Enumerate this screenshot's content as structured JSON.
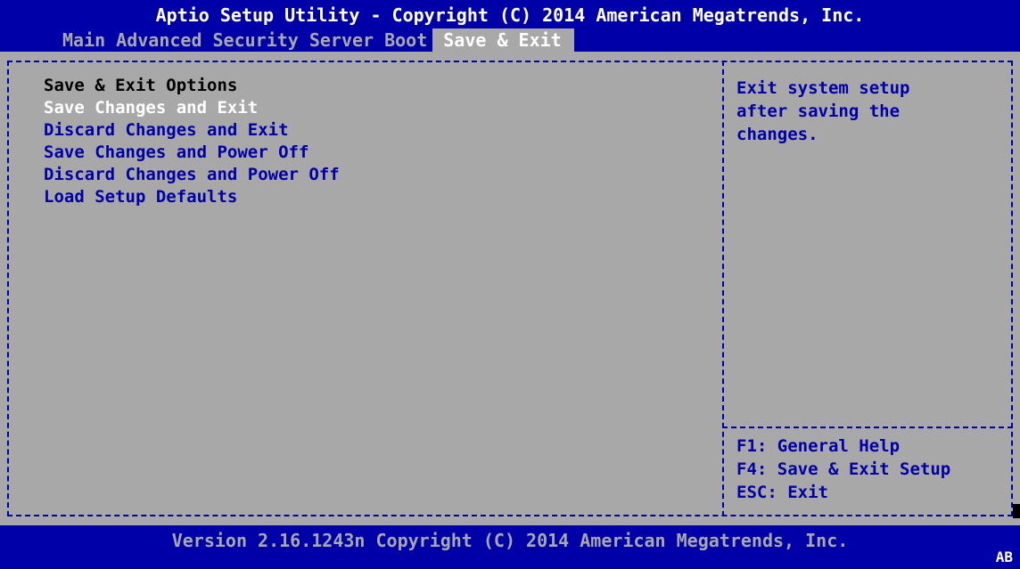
{
  "header": {
    "title": "Aptio Setup Utility - Copyright (C) 2014 American Megatrends, Inc.",
    "tabs": [
      {
        "label": "Main"
      },
      {
        "label": "Advanced"
      },
      {
        "label": "Security"
      },
      {
        "label": "Server"
      },
      {
        "label": "Boot"
      },
      {
        "label": "Save & Exit",
        "active": true
      }
    ]
  },
  "left_pane": {
    "heading": "Save & Exit Options",
    "options": [
      {
        "label": "Save Changes and Exit",
        "selected": true
      },
      {
        "label": "Discard Changes and Exit"
      },
      {
        "label": "Save Changes and Power Off"
      },
      {
        "label": "Discard Changes and Power Off"
      },
      {
        "label": "Load Setup Defaults"
      }
    ]
  },
  "help": {
    "lines": [
      "Exit system setup",
      "after saving the",
      "changes."
    ]
  },
  "keys": {
    "lines": [
      "F1: General Help",
      "F4: Save & Exit Setup",
      "ESC: Exit"
    ]
  },
  "footer": {
    "version": "Version 2.16.1243n Copyright (C) 2014 American Megatrends, Inc.",
    "badge": "AB"
  },
  "colors": {
    "bios_blue": "#0000a8",
    "bios_gray": "#a8a8a8",
    "white": "#ffffff",
    "black": "#000000"
  }
}
